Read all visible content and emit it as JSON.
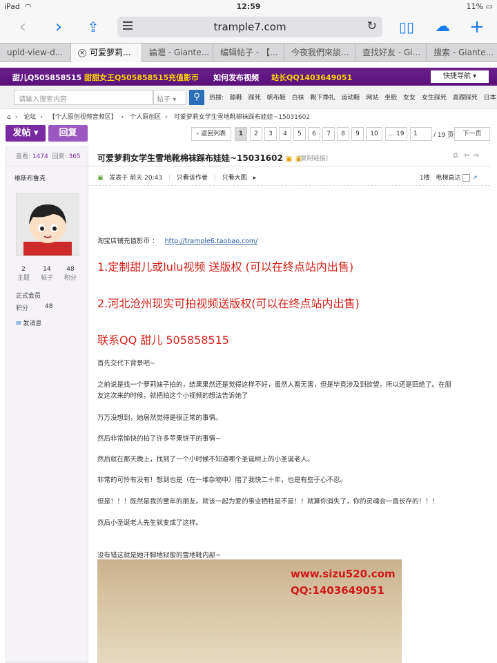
{
  "status_bar": {
    "device": "iPad",
    "time": "12:59",
    "battery": "11%"
  },
  "browser": {
    "url": "trample7.com",
    "tabs": [
      {
        "label": "upld-view-d...",
        "active": false
      },
      {
        "label": "可爱萝莉...",
        "active": true
      },
      {
        "label": "論壇 - Giante...",
        "active": false
      },
      {
        "label": "编辑帖子 - 【...",
        "active": false
      },
      {
        "label": "今夜我們來談...",
        "active": false
      },
      {
        "label": "查找好友 - Gi...",
        "active": false
      },
      {
        "label": "搜索 - Giante...",
        "active": false
      }
    ]
  },
  "topnav": {
    "items": [
      "甜儿Q505858515",
      "甜甜女王Q505858515",
      "充值影币",
      "如何发布视频",
      "站长QQ1403649051"
    ],
    "quicknav": "快捷导航"
  },
  "search": {
    "placeholder": "请输入搜索内容",
    "type": "帖子",
    "hot_label": "热搜:",
    "hot_tags": [
      "舔鞋",
      "踩死",
      "帆布鞋",
      "白袜",
      "靴下挣扎",
      "运动鞋",
      "网站",
      "坐脸",
      "女女",
      "女生踩死",
      "高跟踩死",
      "日本"
    ]
  },
  "breadcrumb": [
    "论坛",
    "【个人原创视频音频区】",
    "个人原创区",
    "可爱萝莉女学生雪地靴棉袜踩布娃娃~15031602"
  ],
  "actions": {
    "post": "发帖",
    "reply": "回复"
  },
  "pagination": {
    "back": "返回列表",
    "pages": [
      "1",
      "2",
      "3",
      "4",
      "5",
      "6",
      "7",
      "8",
      "9",
      "10",
      "... 19"
    ],
    "current": "1",
    "total": "/ 19 页",
    "next": "下一页"
  },
  "sidebar": {
    "views_label": "查看:",
    "views": "1474",
    "replies_label": "回复:",
    "replies": "365",
    "username": "维斯布鲁克",
    "stats": [
      {
        "value": "2",
        "label": "主题"
      },
      {
        "value": "14",
        "label": "帖子"
      },
      {
        "value": "48",
        "label": "积分"
      }
    ],
    "rank": "正式会员",
    "points_label": "积分",
    "points": "48",
    "message": "发消息"
  },
  "post": {
    "title": "可爱萝莉女学生雪地靴棉袜踩布娃娃~15031602",
    "copy_link": "[复制链接]",
    "posted": "发表于 前天 20:43",
    "only_author": "只看该作者",
    "only_big": "只看大图",
    "floor": "1楼",
    "jump": "电梯直达",
    "shop_label": "淘宝店铺充值影币 ：",
    "shop_link": "http://trample6.taobao.com/",
    "highlight1": "1.定制甜儿或lulu视频 送版权 (可以在终点站内出售)",
    "highlight2": "2.河北沧州现实可拍视频送版权(可以在终点站内出售)",
    "contact": "联系QQ 甜儿 505858515",
    "paragraphs": [
      "首先交代下背景吧~",
      "之前说是找一个萝莉妹子拍的，结果果然还是觉得这样不好，虽然人畜无害，但是毕竟涉及到欲望，所以还是回绝了。在朋",
      "友这次来的时候，就把拍这个小视频的想法告诉她了",
      "万万没想到，她居然觉得是很正常的事情。",
      "然后非常愉快的拍了许多苹果饼干的事情~",
      "然后就在那天晚上，找到了一个小时候不知道哪个圣诞树上的小圣诞老人。",
      "非常的可怜有没有！想到也是（在一堆杂物中）陪了我快二十年，也是有些于心不忍。",
      "但是！！！既然是我的童年的朋友。就该一起为爱的事业牺牲是不是！！就算你消失了，你的灵魂会一直长存的！！！",
      "然后小圣诞老人先生就变成了这样。",
      "没有错这就是她汗脚地狱般的雪地靴内部~"
    ],
    "watermark1": "www.sizu520.com",
    "watermark2": "QQ:1403649051"
  },
  "colors": {
    "brand_purple": "#6b1f8a",
    "accent_red": "#d4221a",
    "link": "#225599",
    "ios_blue": "#1a7cf5"
  }
}
